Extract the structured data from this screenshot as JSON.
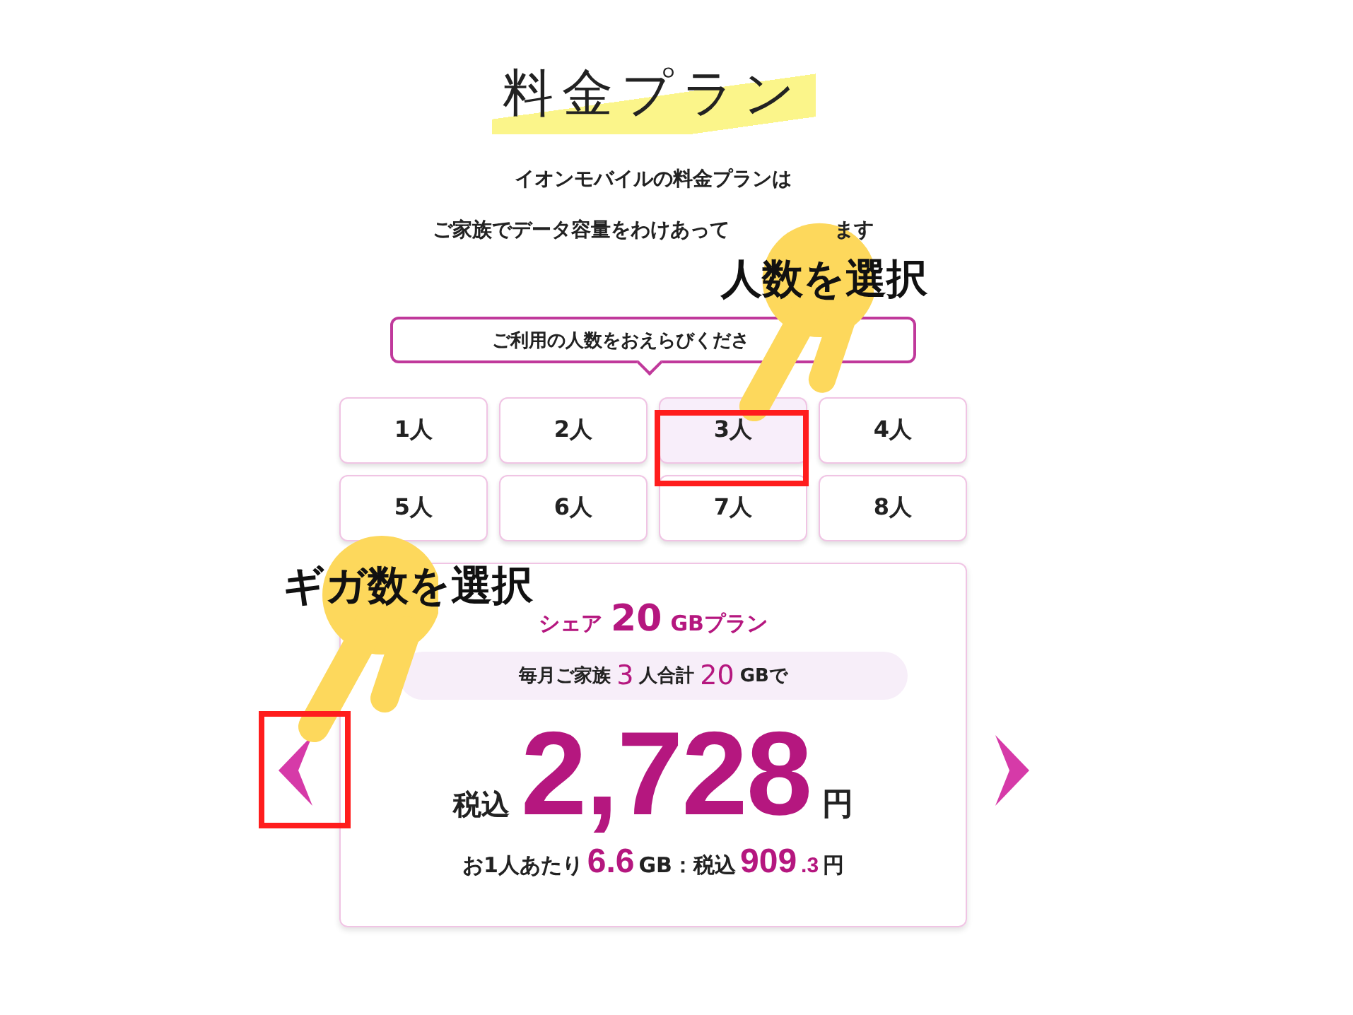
{
  "title": "料金プラン",
  "intro": {
    "line_1": "イオンモバイルの料金プランは",
    "line_2_start": "ご家族でデータ容量をわけあって",
    "line_2_end": "ます"
  },
  "people_prompt": "ご利用の人数をおえらびくださ",
  "people_options": [
    {
      "label": "1人",
      "selected": false
    },
    {
      "label": "2人",
      "selected": false
    },
    {
      "label": "3人",
      "selected": true
    },
    {
      "label": "4人",
      "selected": false
    },
    {
      "label": "5人",
      "selected": false
    },
    {
      "label": "6人",
      "selected": false
    },
    {
      "label": "7人",
      "selected": false
    },
    {
      "label": "8人",
      "selected": false
    }
  ],
  "plan": {
    "share_prefix": "シェア",
    "share_gb": "20",
    "share_suffix": "GBプラン",
    "summary": {
      "prefix": "毎月ご家族",
      "people": "3",
      "middle": "人合計",
      "gb": "20",
      "suffix": "GBで"
    },
    "tax_label": "税込",
    "price": "2,728",
    "yen": "円",
    "per_person": {
      "prefix": "お1人あたり",
      "gb": "6.6",
      "middle": "GB：税込",
      "price": "909",
      "price_decimal": ".3",
      "yen": "円"
    }
  },
  "annotations": [
    {
      "kind": "people",
      "label": "人数を選択"
    },
    {
      "kind": "gigabytes",
      "label": "ギガ数を選択"
    }
  ]
}
